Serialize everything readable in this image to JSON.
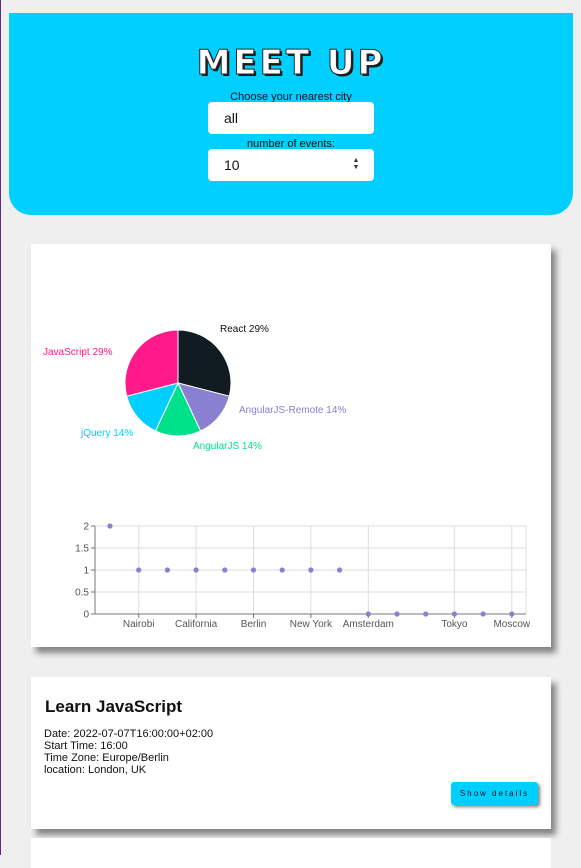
{
  "header": {
    "logo_text": "MEET UP",
    "city_label": "Choose your nearest city",
    "city_value": "all",
    "events_label": "number of events:",
    "events_value": "10"
  },
  "chart_data": [
    {
      "type": "pie",
      "slices": [
        {
          "label": "React",
          "percent": 29,
          "color": "#101c22"
        },
        {
          "label": "AngularJS-Remote",
          "percent": 14,
          "color": "#8a7fd0"
        },
        {
          "label": "AngularJS",
          "percent": 14,
          "color": "#00e08a"
        },
        {
          "label": "jQuery",
          "percent": 14,
          "color": "#00cfff"
        },
        {
          "label": "JavaScript",
          "percent": 29,
          "color": "#ff1a8c"
        }
      ],
      "display_labels": [
        "React 29%",
        "AngularJS-Remote 14%",
        "AngularJS 14%",
        "jQuery 14%",
        "JavaScript 29%"
      ]
    },
    {
      "type": "scatter",
      "x_tick_labels": [
        "Nairobi",
        "California",
        "Berlin",
        "New York",
        "Amsterdam",
        "Tokyo",
        "Moscow"
      ],
      "y_ticks": [
        "0",
        "0.5",
        "1",
        "1.5",
        "2"
      ],
      "ylim": [
        0,
        2
      ],
      "grid": true,
      "values": [
        2,
        1,
        1,
        1,
        1,
        1,
        1,
        1,
        1,
        0,
        0,
        0,
        0,
        0,
        0
      ],
      "point_color": "#8a7fd0"
    }
  ],
  "event": {
    "title": "Learn JavaScript",
    "date": "Date: 2022-07-07T16:00:00+02:00",
    "start_time": "Start Time: 16:00",
    "time_zone": "Time Zone: Europe/Berlin",
    "location": "location: London, UK",
    "button_label": "Show details"
  }
}
